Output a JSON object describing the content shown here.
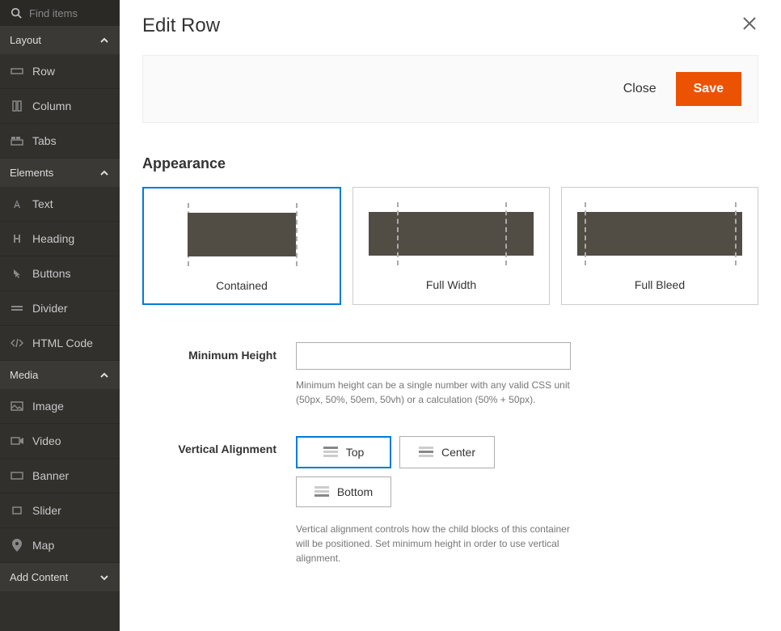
{
  "sidebar": {
    "search_placeholder": "Find items",
    "sections": {
      "layout": {
        "label": "Layout",
        "items": [
          "Row",
          "Column",
          "Tabs"
        ]
      },
      "elements": {
        "label": "Elements",
        "items": [
          "Text",
          "Heading",
          "Buttons",
          "Divider",
          "HTML Code"
        ]
      },
      "media": {
        "label": "Media",
        "items": [
          "Image",
          "Video",
          "Banner",
          "Slider",
          "Map"
        ]
      },
      "add_content": {
        "label": "Add Content"
      }
    }
  },
  "panel": {
    "title": "Edit Row",
    "close_label": "Close",
    "save_label": "Save"
  },
  "appearance": {
    "section_title": "Appearance",
    "options": [
      "Contained",
      "Full Width",
      "Full Bleed"
    ],
    "selected": "Contained"
  },
  "min_height": {
    "label": "Minimum Height",
    "value": "",
    "help": "Minimum height can be a single number with any valid CSS unit (50px, 50%, 50em, 50vh) or a calculation (50% + 50px)."
  },
  "valign": {
    "label": "Vertical Alignment",
    "options": [
      "Top",
      "Center",
      "Bottom"
    ],
    "selected": "Top",
    "help": "Vertical alignment controls how the child blocks of this container will be positioned. Set minimum height in order to use vertical alignment."
  }
}
